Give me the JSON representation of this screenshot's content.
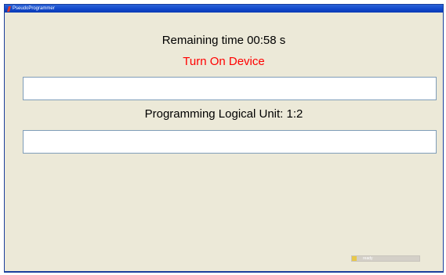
{
  "window": {
    "title": "PseudoProgrammer",
    "icon": "app-logo-icon"
  },
  "main": {
    "remaining_time": "Remaining time 00:58 s",
    "device_status": "Turn On Device",
    "device_status_color": "#ff0000",
    "logical_unit": "Programming Logical Unit: 1:2",
    "field1_value": "",
    "field2_value": ""
  },
  "progress": {
    "fraction": 0.07,
    "label": "ready",
    "fill_color": "#e8c84a"
  }
}
